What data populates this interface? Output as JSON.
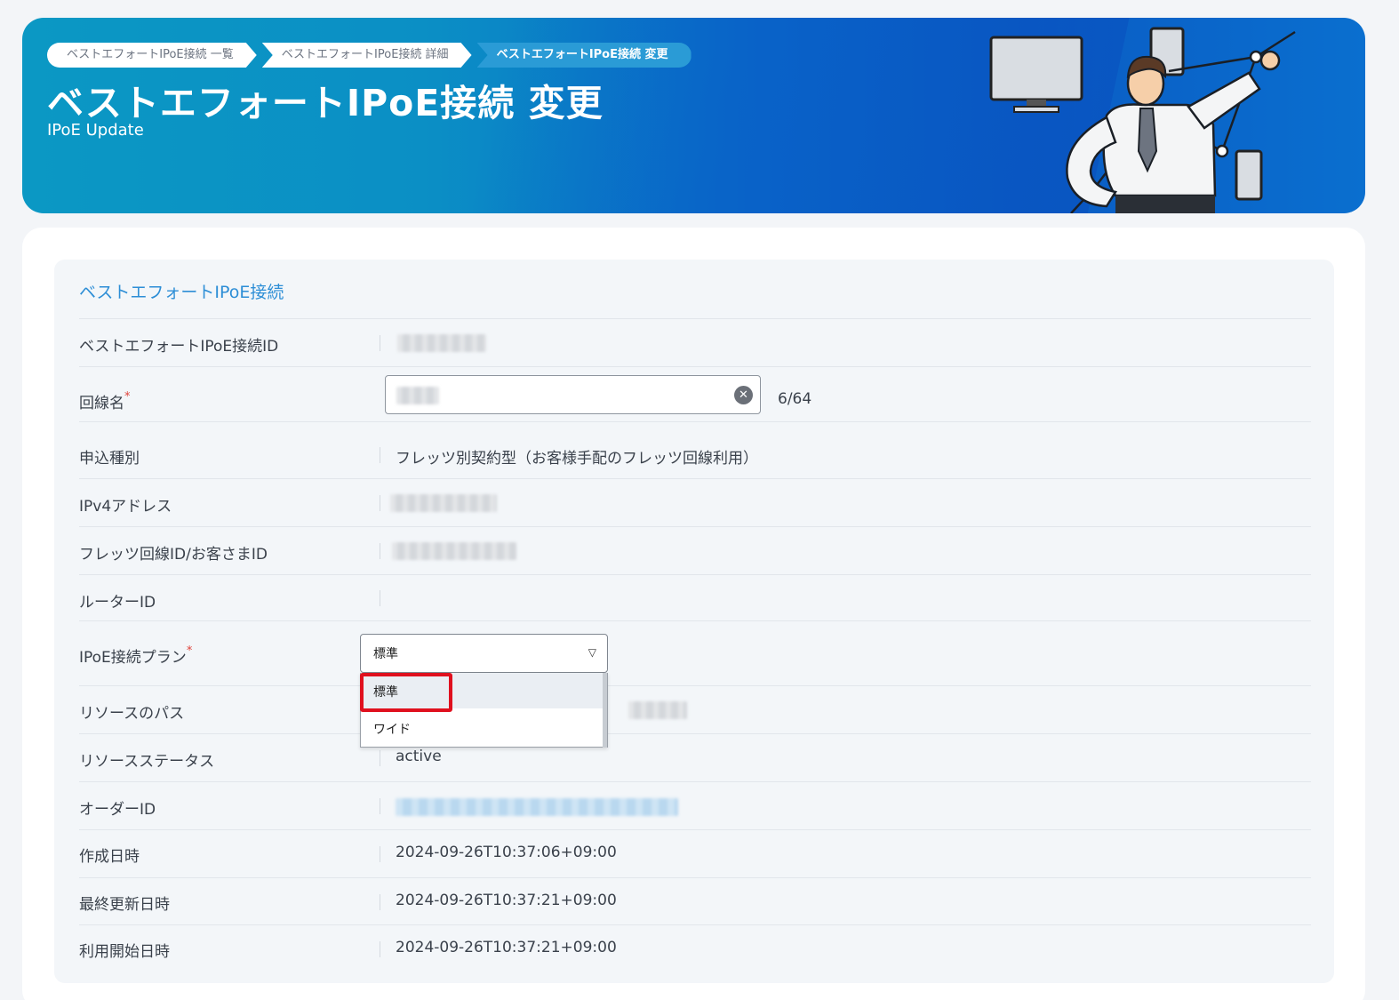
{
  "breadcrumb": [
    {
      "label": "ベストエフォートIPoE接続 一覧"
    },
    {
      "label": "ベストエフォートIPoE接続 詳細"
    },
    {
      "label": "ベストエフォートIPoE接続 変更"
    }
  ],
  "header": {
    "title": "ベストエフォートIPoE接続 変更",
    "subtitle": "IPoE Update"
  },
  "section": {
    "title": "ベストエフォートIPoE接続"
  },
  "fields": {
    "connection_id": {
      "label": "ベストエフォートIPoE接続ID",
      "value": "(blurred)"
    },
    "line_name": {
      "label": "回線名",
      "required_mark": "*",
      "value": "(blurred)",
      "counter": "6/64"
    },
    "application_type": {
      "label": "申込種別",
      "value": "フレッツ別契約型（お客様手配のフレッツ回線利用）"
    },
    "ipv4": {
      "label": "IPv4アドレス",
      "value": "(blurred)"
    },
    "flets_id": {
      "label": "フレッツ回線ID/お客さまID",
      "value": "(blurred)"
    },
    "router_id": {
      "label": "ルーターID",
      "value": ""
    },
    "plan": {
      "label": "IPoE接続プラン",
      "required_mark": "*",
      "selected": "標準",
      "options": [
        "標準",
        "ワイド"
      ]
    },
    "resource_path": {
      "label": "リソースのパス",
      "value": "(blurred)"
    },
    "resource_status": {
      "label": "リソースステータス",
      "value": "active"
    },
    "order_id": {
      "label": "オーダーID",
      "value": "(blurred)"
    },
    "created_at": {
      "label": "作成日時",
      "value": "2024-09-26T10:37:06+09:00"
    },
    "updated_at": {
      "label": "最終更新日時",
      "value": "2024-09-26T10:37:21+09:00"
    },
    "started_at": {
      "label": "利用開始日時",
      "value": "2024-09-26T10:37:21+09:00"
    }
  },
  "colors": {
    "accent": "#2d8ed6",
    "banner_start": "#0b98c4",
    "banner_end": "#0a5cc4",
    "required": "#e0443c",
    "highlight": "#e0101e"
  }
}
